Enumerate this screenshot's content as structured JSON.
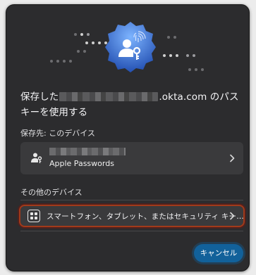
{
  "dialog": {
    "title_prefix": "保存した",
    "title_suffix": ".okta.com のパスキーを使用する",
    "save_to_label": "保存先: このデバイス",
    "saved_card": {
      "provider": "Apple Passwords",
      "icon": "person-key-icon"
    },
    "other_devices_label": "その他のデバイス",
    "other_option": {
      "label": "スマートフォン、タブレット、またはセキュリティ キー…",
      "icon": "qr-grid-icon"
    },
    "cancel_label": "キャンセル"
  },
  "colors": {
    "background": "#2c2c2e",
    "card": "#3a3a3c",
    "accent": "#12619a",
    "badge_gradient": [
      "#6fa8ff",
      "#1f4fb8"
    ],
    "highlight": "#a13a1a"
  }
}
